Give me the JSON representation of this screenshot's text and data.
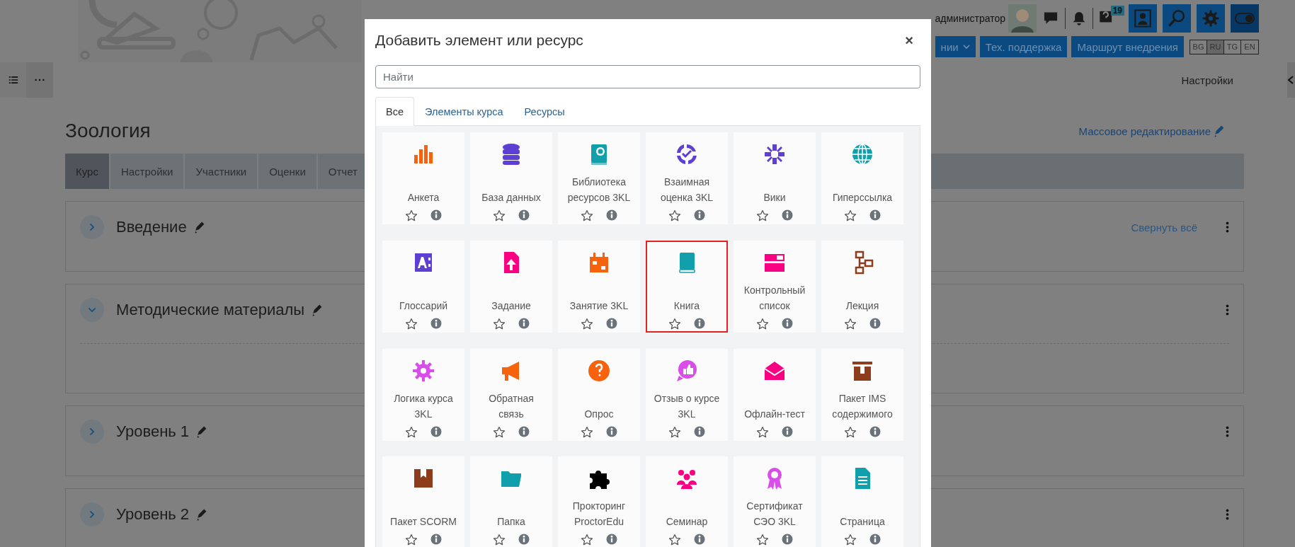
{
  "header": {
    "user_name": "администратор",
    "notification_count": "19",
    "nav_buttons": [
      {
        "label": "нии",
        "dropdown": true
      },
      {
        "label": "Тех. поддержка",
        "dropdown": false
      },
      {
        "label": "Маршрут внедрения",
        "dropdown": false
      }
    ],
    "languages": [
      {
        "label": "BG",
        "selected": false
      },
      {
        "label": "RU",
        "selected": true
      },
      {
        "label": "TG",
        "selected": false
      },
      {
        "label": "EN",
        "selected": false
      }
    ]
  },
  "settings_link": "Настройки",
  "course": {
    "title": "Зоология",
    "bulk_edit": "Массовое редактирование",
    "tabs": [
      {
        "label": "Курс",
        "selected": true
      },
      {
        "label": "Настройки",
        "selected": false
      },
      {
        "label": "Участники",
        "selected": false
      },
      {
        "label": "Оценки",
        "selected": false
      },
      {
        "label": "Отчет",
        "selected": false
      }
    ],
    "collapse_all": "Свернуть всё",
    "sections": [
      {
        "title": "Введение",
        "expanded": false
      },
      {
        "title": "Методические материалы",
        "expanded": true
      },
      {
        "title": "Уровень 1",
        "expanded": false
      },
      {
        "title": "Уровень 2",
        "expanded": false
      }
    ]
  },
  "modal": {
    "title": "Добавить элемент или ресурс",
    "close": "×",
    "search": {
      "placeholder": "Найти"
    },
    "tabs": [
      {
        "label": "Все",
        "selected": true
      },
      {
        "label": "Элементы курса",
        "selected": false
      },
      {
        "label": "Ресурсы",
        "selected": false
      }
    ],
    "items": [
      {
        "label": "Анкета",
        "color": "#f7630c",
        "selected": false
      },
      {
        "label": "База данных",
        "color": "#5d3fd3",
        "selected": false
      },
      {
        "label": "Библиотека ресурсов 3KL",
        "color": "#11a0ab",
        "selected": false
      },
      {
        "label": "Взаимная оценка 3KL",
        "color": "#5d3fd3",
        "selected": false
      },
      {
        "label": "Вики",
        "color": "#5d3fd3",
        "selected": false
      },
      {
        "label": "Гиперссылка",
        "color": "#11a0ab",
        "selected": false
      },
      {
        "label": "Глоссарий",
        "color": "#5d3fd3",
        "selected": false
      },
      {
        "label": "Задание",
        "color": "#f90083",
        "selected": false
      },
      {
        "label": "Занятие 3KL",
        "color": "#f7630c",
        "selected": false
      },
      {
        "label": "Книга",
        "color": "#11a0ab",
        "selected": true
      },
      {
        "label": "Контрольный список",
        "color": "#f90083",
        "selected": false
      },
      {
        "label": "Лекция",
        "color": "#8d3d1b",
        "selected": false
      },
      {
        "label": "Логика курса 3KL",
        "color": "#d94ee8",
        "selected": false
      },
      {
        "label": "Обратная связь",
        "color": "#f7630c",
        "selected": false
      },
      {
        "label": "Опрос",
        "color": "#f7630c",
        "selected": false
      },
      {
        "label": "Отзыв о курсе 3KL",
        "color": "#d94ee8",
        "selected": false
      },
      {
        "label": "Офлайн-тест",
        "color": "#f90083",
        "selected": false
      },
      {
        "label": "Пакет IMS содержимого",
        "color": "#8d3d1b",
        "selected": false
      },
      {
        "label": "Пакет SCORM",
        "color": "#8d3d1b",
        "selected": false
      },
      {
        "label": "Папка",
        "color": "#11a0ab",
        "selected": false
      },
      {
        "label": "Прокторинг ProctorEdu",
        "color": "#000000",
        "selected": false
      },
      {
        "label": "Семинар",
        "color": "#f90083",
        "selected": false
      },
      {
        "label": "Сертификат СЭО 3KL",
        "color": "#d94ee8",
        "selected": false
      },
      {
        "label": "Страница",
        "color": "#11a0ab",
        "selected": false
      }
    ]
  }
}
